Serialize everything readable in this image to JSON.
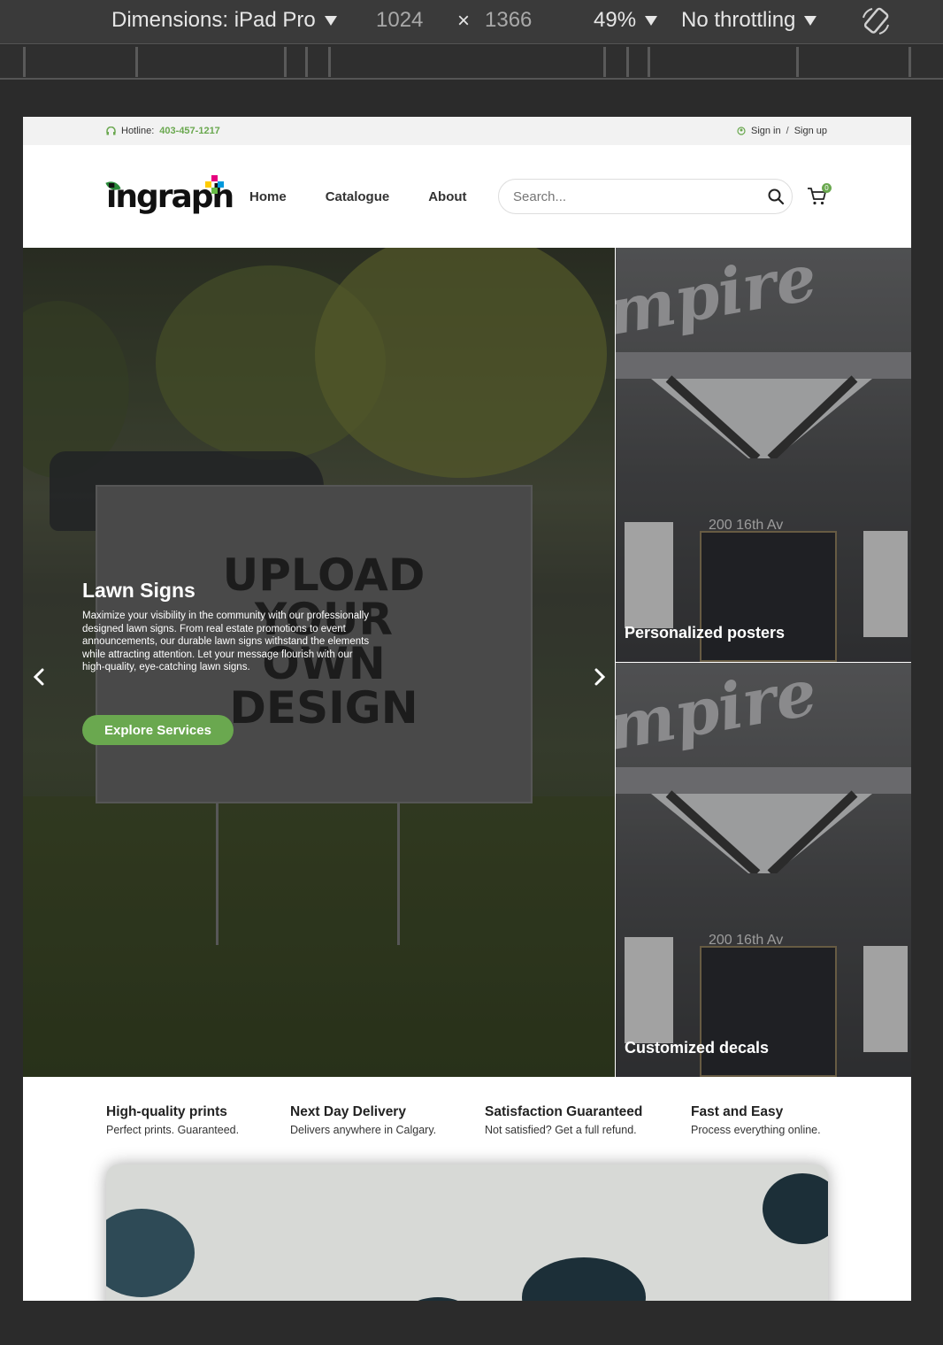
{
  "devtools": {
    "dimensions_label": "Dimensions: iPad Pro",
    "width": "1024",
    "times": "×",
    "height": "1366",
    "zoom": "49%",
    "throttling": "No throttling"
  },
  "topbar": {
    "hotline_label": "Hotline:",
    "hotline_number": "403-457-1217",
    "sign_in": "Sign in",
    "separator": "/",
    "sign_up": "Sign up"
  },
  "header": {
    "logo_text": "ingraph",
    "nav": [
      {
        "label": "Home"
      },
      {
        "label": "Catalogue"
      },
      {
        "label": "About"
      }
    ],
    "search_placeholder": "Search...",
    "cart_count": "0"
  },
  "hero": {
    "sign_text": "UPLOAD YOUR OWN DESIGN",
    "title": "Lawn Signs",
    "description": "Maximize your visibility in the community with our professionally designed lawn signs. From real estate promotions to event announcements, our durable lawn signs withstand the elements while attracting attention. Let your message flourish with our high-quality, eye-catching lawn signs.",
    "button": "Explore Services"
  },
  "tiles": [
    {
      "label": "Personalized posters",
      "script": "mpire",
      "address": "200 16th Av"
    },
    {
      "label": "Customized decals",
      "script": "mpire",
      "address": "200 16th Av"
    }
  ],
  "features": [
    {
      "title": "High-quality prints",
      "desc": "Perfect prints. Guaranteed."
    },
    {
      "title": "Next Day Delivery",
      "desc": "Delivers anywhere in Calgary."
    },
    {
      "title": "Satisfaction Guaranteed",
      "desc": "Not satisfied? Get a full refund."
    },
    {
      "title": "Fast and Easy",
      "desc": "Process everything online."
    }
  ],
  "colors": {
    "accent": "#6aa84f",
    "topbar_bg": "#f2f2f2"
  }
}
